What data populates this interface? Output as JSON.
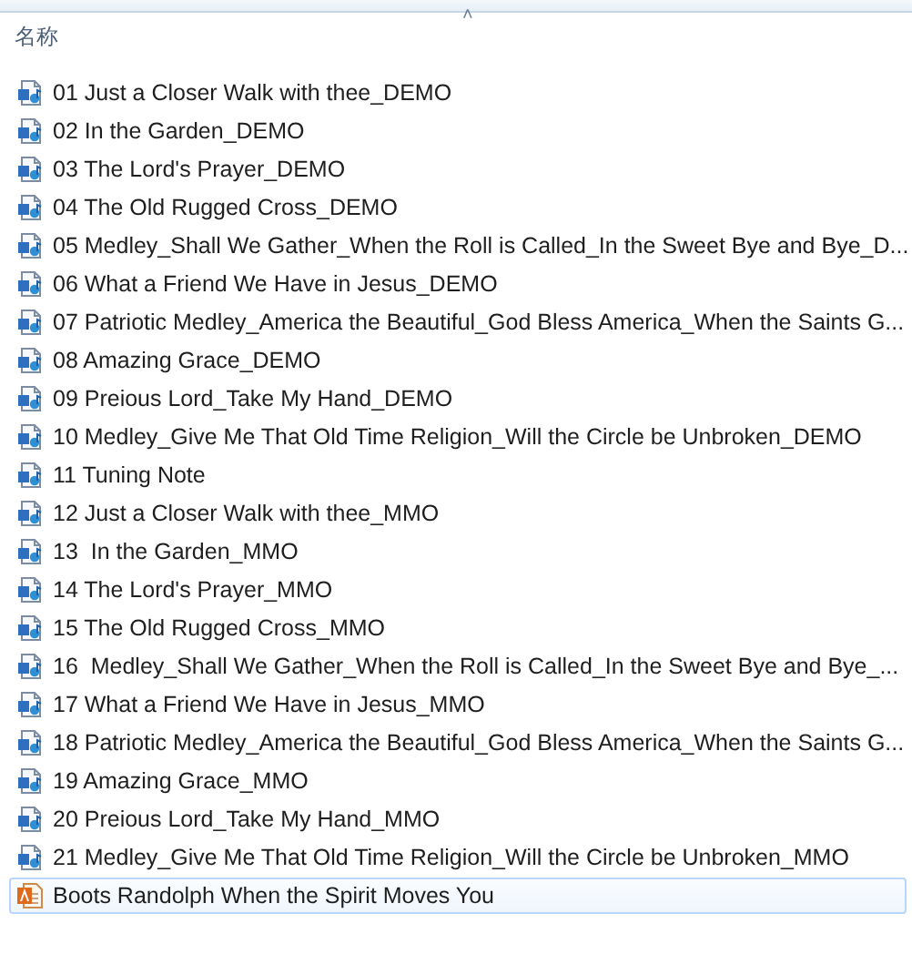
{
  "header": {
    "column_1": "名称",
    "sort_indicator": "˄"
  },
  "files": [
    {
      "name": "01 Just a Closer Walk with thee_DEMO",
      "kind": "audio",
      "selected": false
    },
    {
      "name": "02 In the Garden_DEMO",
      "kind": "audio",
      "selected": false
    },
    {
      "name": "03 The Lord's Prayer_DEMO",
      "kind": "audio",
      "selected": false
    },
    {
      "name": "04 The Old Rugged Cross_DEMO",
      "kind": "audio",
      "selected": false
    },
    {
      "name": "05 Medley_Shall We Gather_When the Roll is Called_In the Sweet Bye and Bye_D...",
      "kind": "audio",
      "selected": false
    },
    {
      "name": "06 What a Friend We Have in Jesus_DEMO",
      "kind": "audio",
      "selected": false
    },
    {
      "name": "07 Patriotic Medley_America the Beautiful_God Bless America_When the Saints G...",
      "kind": "audio",
      "selected": false
    },
    {
      "name": "08 Amazing Grace_DEMO",
      "kind": "audio",
      "selected": false
    },
    {
      "name": "09 Preious Lord_Take My Hand_DEMO",
      "kind": "audio",
      "selected": false
    },
    {
      "name": "10 Medley_Give Me That Old Time Religion_Will the Circle be Unbroken_DEMO",
      "kind": "audio",
      "selected": false
    },
    {
      "name": "11 Tuning Note",
      "kind": "audio",
      "selected": false
    },
    {
      "name": "12 Just a Closer Walk with thee_MMO",
      "kind": "audio",
      "selected": false
    },
    {
      "name": "13  In the Garden_MMO",
      "kind": "audio",
      "selected": false
    },
    {
      "name": "14 The Lord's Prayer_MMO",
      "kind": "audio",
      "selected": false
    },
    {
      "name": "15 The Old Rugged Cross_MMO",
      "kind": "audio",
      "selected": false
    },
    {
      "name": "16  Medley_Shall We Gather_When the Roll is Called_In the Sweet Bye and Bye_...",
      "kind": "audio",
      "selected": false
    },
    {
      "name": "17 What a Friend We Have in Jesus_MMO",
      "kind": "audio",
      "selected": false
    },
    {
      "name": "18 Patriotic Medley_America the Beautiful_God Bless America_When the Saints G...",
      "kind": "audio",
      "selected": false
    },
    {
      "name": "19 Amazing Grace_MMO",
      "kind": "audio",
      "selected": false
    },
    {
      "name": "20 Preious Lord_Take My Hand_MMO",
      "kind": "audio",
      "selected": false
    },
    {
      "name": "21 Medley_Give Me That Old Time Religion_Will the Circle be Unbroken_MMO",
      "kind": "audio",
      "selected": false
    },
    {
      "name": "Boots Randolph When the Spirit Moves You",
      "kind": "pdf",
      "selected": true
    }
  ]
}
